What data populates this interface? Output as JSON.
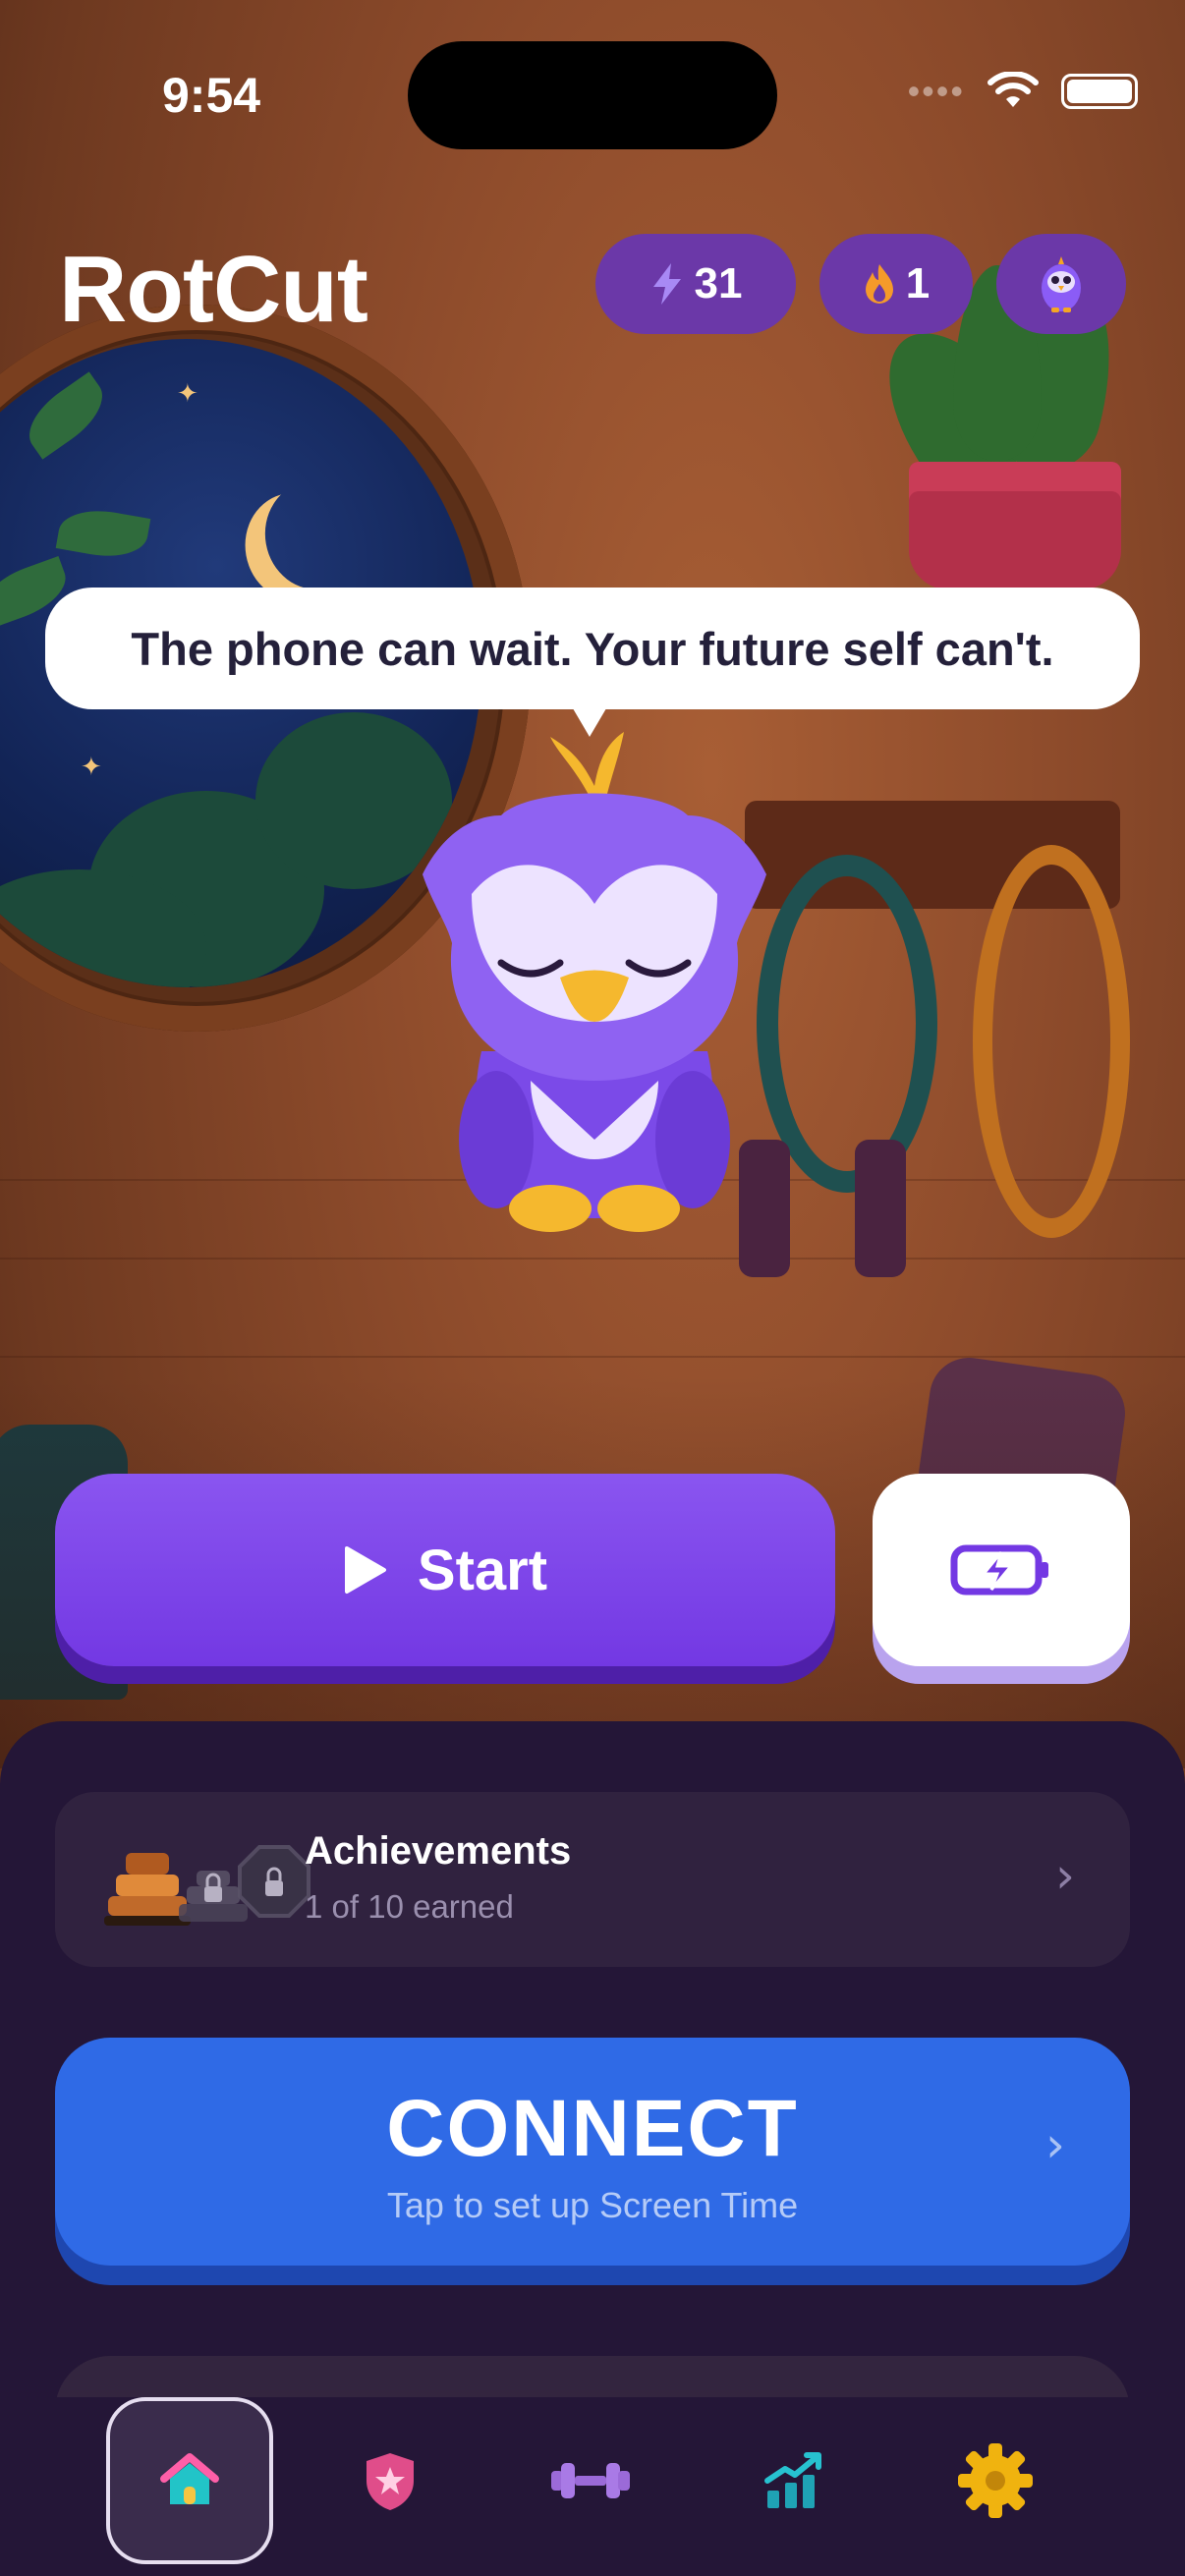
{
  "status_bar": {
    "time": "9:54"
  },
  "header": {
    "title": "RotCut",
    "energy_count": "31",
    "streak_count": "1"
  },
  "mascot": {
    "speech": "The phone can wait. Your future self can't."
  },
  "actions": {
    "start_label": "Start"
  },
  "achievements": {
    "title": "Achievements",
    "subtitle": "1 of 10 earned"
  },
  "connect": {
    "title": "CONNECT",
    "subtitle": "Tap to set up Screen Time"
  },
  "tabbar": {
    "items": [
      {
        "icon": "home-icon",
        "active": true
      },
      {
        "icon": "shield-star-icon",
        "active": false
      },
      {
        "icon": "dumbbell-icon",
        "active": false
      },
      {
        "icon": "chart-up-icon",
        "active": false
      },
      {
        "icon": "gear-icon",
        "active": false
      }
    ]
  },
  "colors": {
    "primary_purple": "#7338e3",
    "connect_blue": "#2f6ae6",
    "sheet_bg": "#241637",
    "gear_yellow": "#f0b30f"
  }
}
